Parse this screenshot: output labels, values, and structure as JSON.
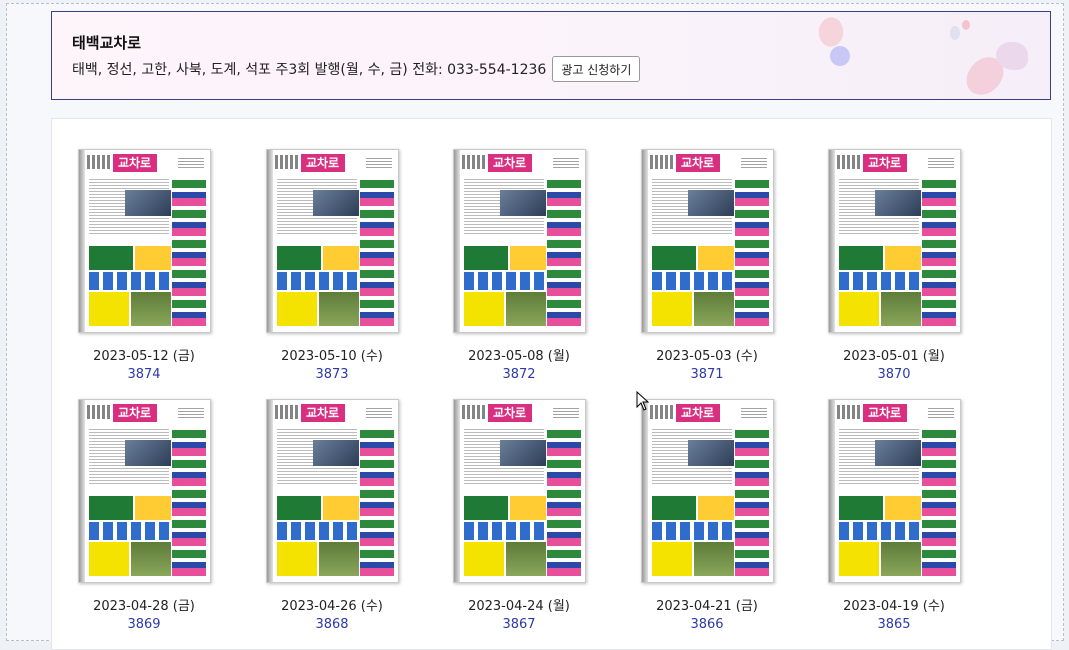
{
  "header": {
    "title": "태백교차로",
    "info": "태백, 정선, 고한, 사북, 도계, 석포 주3회 발행(월, 수, 금) 전화: 033-554-1236",
    "ad_button": "광고 신청하기"
  },
  "issues": [
    {
      "date": "2023-05-12 (금)",
      "number": "3874"
    },
    {
      "date": "2023-05-10 (수)",
      "number": "3873"
    },
    {
      "date": "2023-05-08 (월)",
      "number": "3872"
    },
    {
      "date": "2023-05-03 (수)",
      "number": "3871"
    },
    {
      "date": "2023-05-01 (월)",
      "number": "3870"
    },
    {
      "date": "2023-04-28 (금)",
      "number": "3869"
    },
    {
      "date": "2023-04-26 (수)",
      "number": "3868"
    },
    {
      "date": "2023-04-24 (월)",
      "number": "3867"
    },
    {
      "date": "2023-04-21 (금)",
      "number": "3866"
    },
    {
      "date": "2023-04-19 (수)",
      "number": "3865"
    }
  ],
  "thumbnail_masthead": "교차로",
  "colors": {
    "header_border": "#3d3f86",
    "issue_number": "#2b3aa8",
    "masthead": "#d92f80"
  }
}
